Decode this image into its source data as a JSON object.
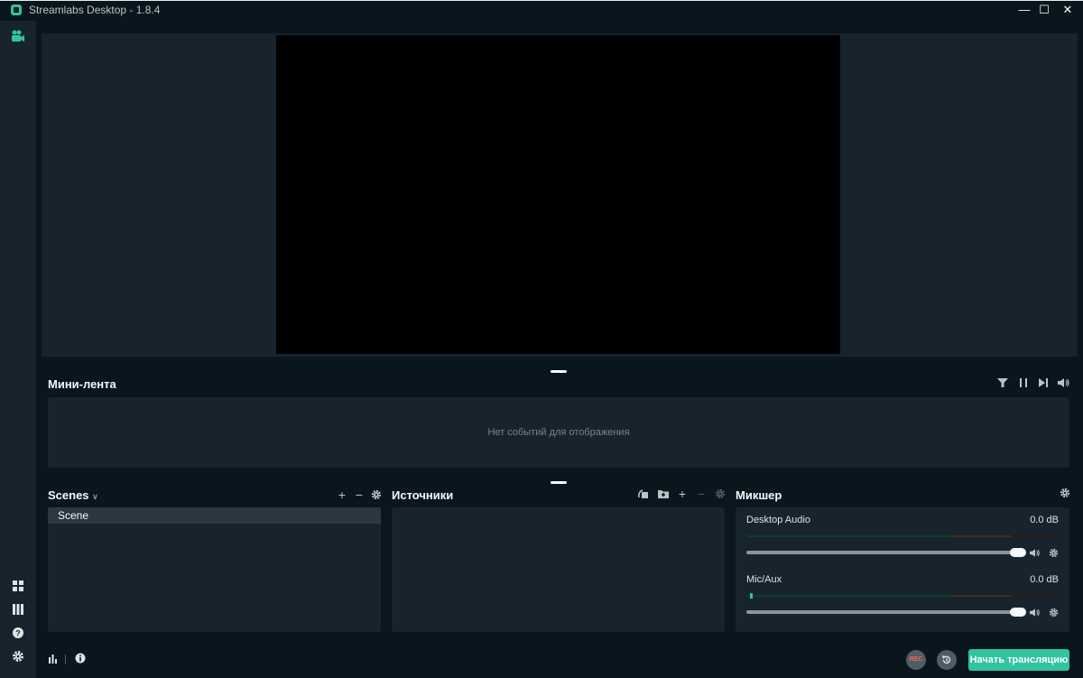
{
  "window": {
    "title": "Streamlabs Desktop - 1.8.4",
    "minimize": "—",
    "maximize": "☐",
    "close": "✕"
  },
  "colors": {
    "accent": "#31c3a2",
    "background": "#09161d",
    "panel": "#17242d",
    "rec": "#fb5e5e"
  },
  "nav": {
    "top_icon": "studio-camera-icon",
    "bottom_icons": [
      "layout-editor-icon",
      "studio-mode-icon",
      "help-icon",
      "settings-icon"
    ]
  },
  "minifeed": {
    "title": "Мини-лента",
    "empty_message": "Нет событий для отображения",
    "icons": [
      "filter-icon",
      "pause-icon",
      "skip-icon",
      "volume-icon"
    ]
  },
  "scenes": {
    "title": "Scenes",
    "items": [
      {
        "label": "Scene"
      }
    ]
  },
  "sources": {
    "title": "Источники"
  },
  "mixer": {
    "title": "Микшер",
    "channels": [
      {
        "name": "Desktop Audio",
        "level": "0.0 dB",
        "volume": 1.0
      },
      {
        "name": "Mic/Aux",
        "level": "0.0 dB",
        "volume": 1.0
      }
    ]
  },
  "footer": {
    "rec_label": "REC",
    "go_live_label": "Начать трансляцию"
  }
}
